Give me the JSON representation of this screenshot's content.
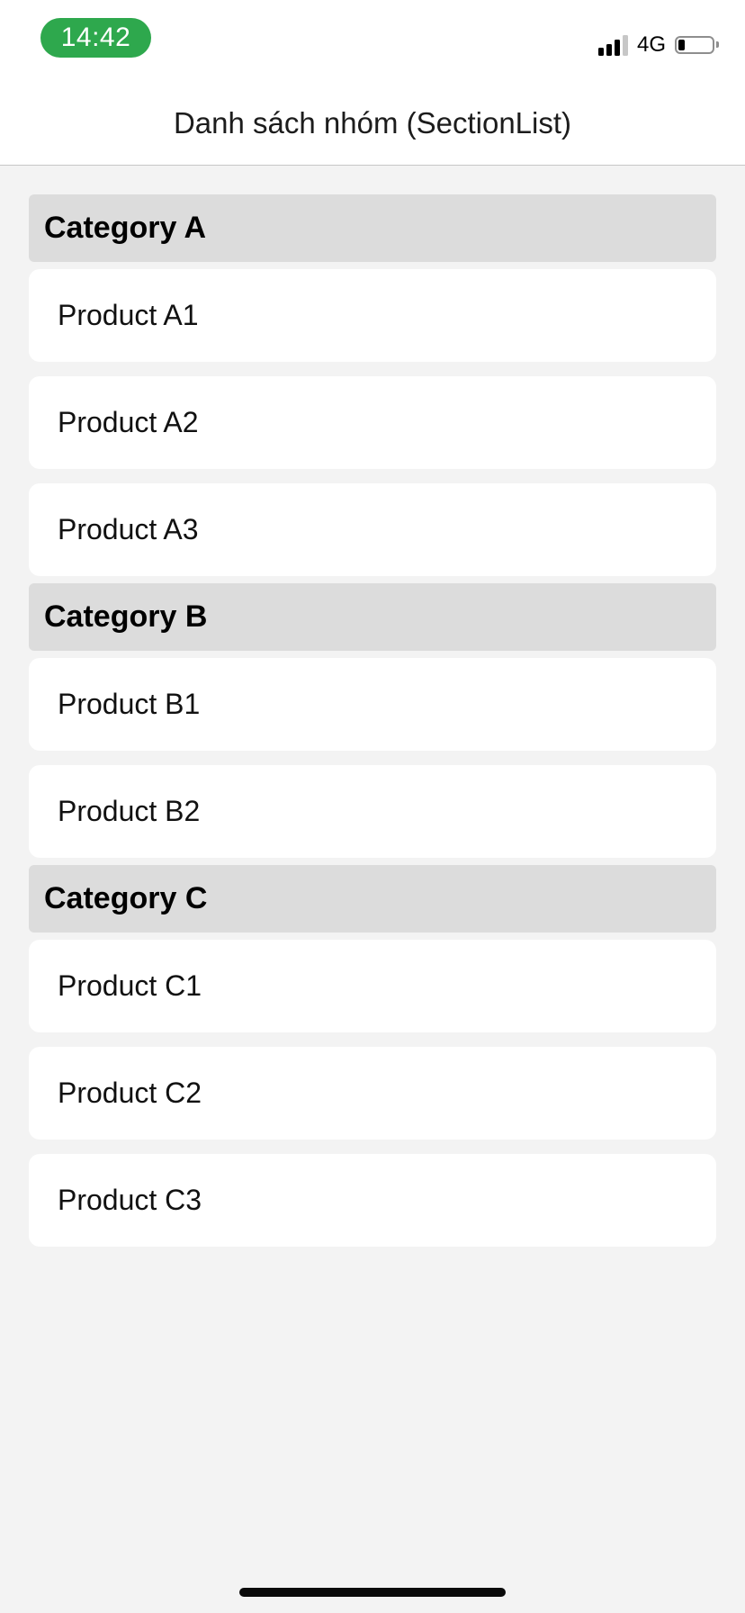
{
  "status_bar": {
    "time": "14:42",
    "network": "4G",
    "signal_icon": "cellular-signal-icon",
    "battery_icon": "battery-icon"
  },
  "header": {
    "title": "Danh sách nhóm (SectionList)"
  },
  "sections": [
    {
      "title": "Category A",
      "items": [
        {
          "label": "Product A1"
        },
        {
          "label": "Product A2"
        },
        {
          "label": "Product A3"
        }
      ]
    },
    {
      "title": "Category B",
      "items": [
        {
          "label": "Product B1"
        },
        {
          "label": "Product B2"
        }
      ]
    },
    {
      "title": "Category C",
      "items": [
        {
          "label": "Product C1"
        },
        {
          "label": "Product C2"
        },
        {
          "label": "Product C3"
        }
      ]
    }
  ],
  "colors": {
    "time_pill": "#2ea84d",
    "section_header_bg": "#dcdcdc",
    "item_bg": "#ffffff",
    "screen_bg": "#f3f3f3"
  }
}
